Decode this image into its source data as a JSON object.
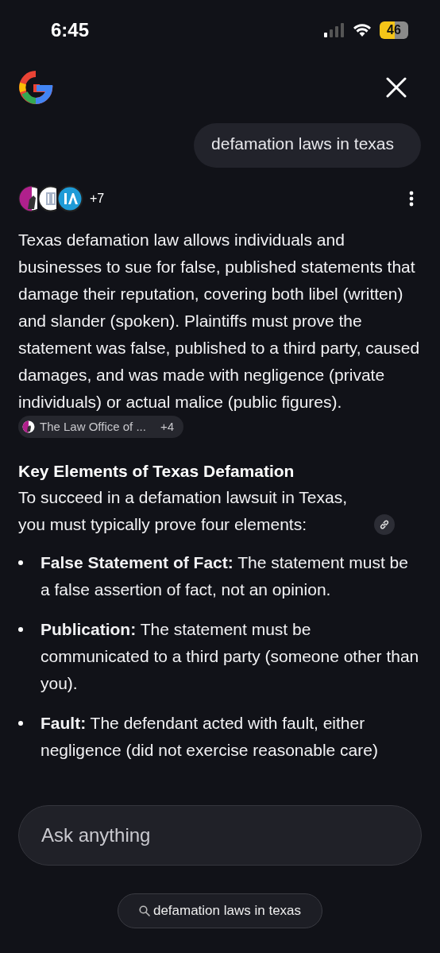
{
  "status_bar": {
    "time": "6:45",
    "battery": "46"
  },
  "query": "defamation laws in texas",
  "sources": {
    "more": "+7"
  },
  "answer": "Texas defamation law allows individuals and businesses to sue for false, published statements that damage their reputation, covering both libel (written) and slander (spoken). Plaintiffs must prove the statement was false, published to a third party, caused damages, and was made with negligence (private individuals) or actual malice (public figures).",
  "citation": {
    "label": "The Law Office of ...",
    "more": "+4"
  },
  "heading": "Key Elements of Texas Defamation",
  "intro": "To succeed in a defamation lawsuit in Texas, you must typically prove four elements:",
  "bullets": [
    "**False Statement of Fact:** The statement must be a false assertion of fact, not an opinion.",
    "**Publication:** The statement must be communicated to a third party (someone other than you).",
    "**Fault:** The defendant acted with fault, either negligence (did not exercise reasonable care)"
  ],
  "input": {
    "placeholder": "Ask anything"
  },
  "suggestion": "defamation laws in texas"
}
